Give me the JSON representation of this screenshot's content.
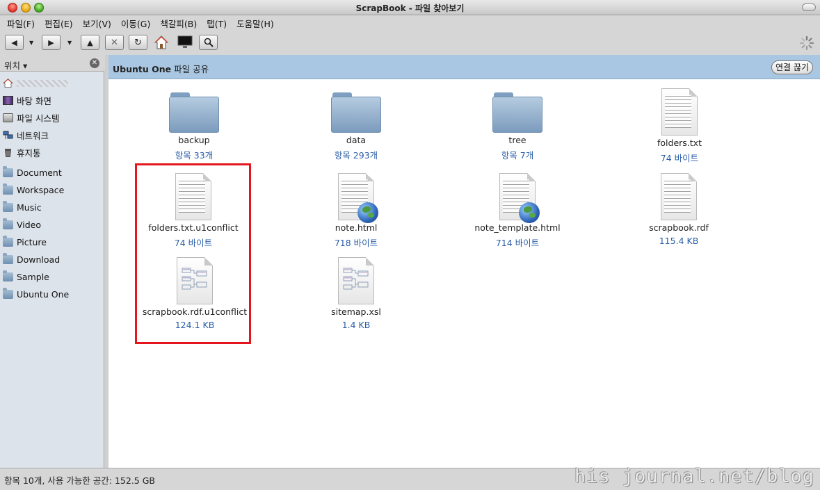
{
  "window": {
    "title": "ScrapBook - 파일 찾아보기"
  },
  "menubar": [
    {
      "label": "파일(F)"
    },
    {
      "label": "편집(E)"
    },
    {
      "label": "보기(V)"
    },
    {
      "label": "이동(G)"
    },
    {
      "label": "책갈피(B)"
    },
    {
      "label": "탭(T)"
    },
    {
      "label": "도움말(H)"
    }
  ],
  "toolbar": {
    "back_icon": "left-arrow-icon",
    "forward_icon": "right-arrow-icon",
    "up_icon": "up-arrow-icon",
    "stop_icon": "stop-icon",
    "reload_icon": "reload-icon",
    "home_icon": "home-icon",
    "computer_icon": "computer-icon",
    "search_icon": "search-icon",
    "busy_icon": "spinner-icon"
  },
  "sidebar": {
    "title": "위치",
    "items": [
      {
        "label": "바탕 화면",
        "icon": "desktop-icon"
      },
      {
        "label": "파일 시스템",
        "icon": "drive-icon"
      },
      {
        "label": "네트워크",
        "icon": "network-icon"
      },
      {
        "label": "휴지통",
        "icon": "trash-icon"
      }
    ],
    "bookmarks": [
      {
        "label": "Document"
      },
      {
        "label": "Workspace"
      },
      {
        "label": "Music"
      },
      {
        "label": "Video"
      },
      {
        "label": "Picture"
      },
      {
        "label": "Download"
      },
      {
        "label": "Sample"
      },
      {
        "label": "Ubuntu One"
      }
    ]
  },
  "infobar": {
    "brand": "Ubuntu One",
    "text": " 파일 공유",
    "button": "연결 끊기"
  },
  "files": [
    {
      "name": "backup",
      "meta": "항목 33개",
      "kind": "folder"
    },
    {
      "name": "data",
      "meta": "항목 293개",
      "kind": "folder"
    },
    {
      "name": "tree",
      "meta": "항목 7개",
      "kind": "folder"
    },
    {
      "name": "folders.txt",
      "meta": "74 바이트",
      "kind": "text"
    },
    {
      "name": "folders.txt.u1conflict",
      "meta": "74 바이트",
      "kind": "text"
    },
    {
      "name": "note.html",
      "meta": "718 바이트",
      "kind": "html"
    },
    {
      "name": "note_template.html",
      "meta": "714 바이트",
      "kind": "html"
    },
    {
      "name": "scrapbook.rdf",
      "meta": "115.4 KB",
      "kind": "text"
    },
    {
      "name": "scrapbook.rdf.u1conflict",
      "meta": "124.1 KB",
      "kind": "diagram"
    },
    {
      "name": "sitemap.xsl",
      "meta": "1.4 KB",
      "kind": "diagram"
    }
  ],
  "status": {
    "text": "항목 10개, 사용 가능한 공간: 152.5 GB"
  },
  "watermark": "his journal.net/blog"
}
